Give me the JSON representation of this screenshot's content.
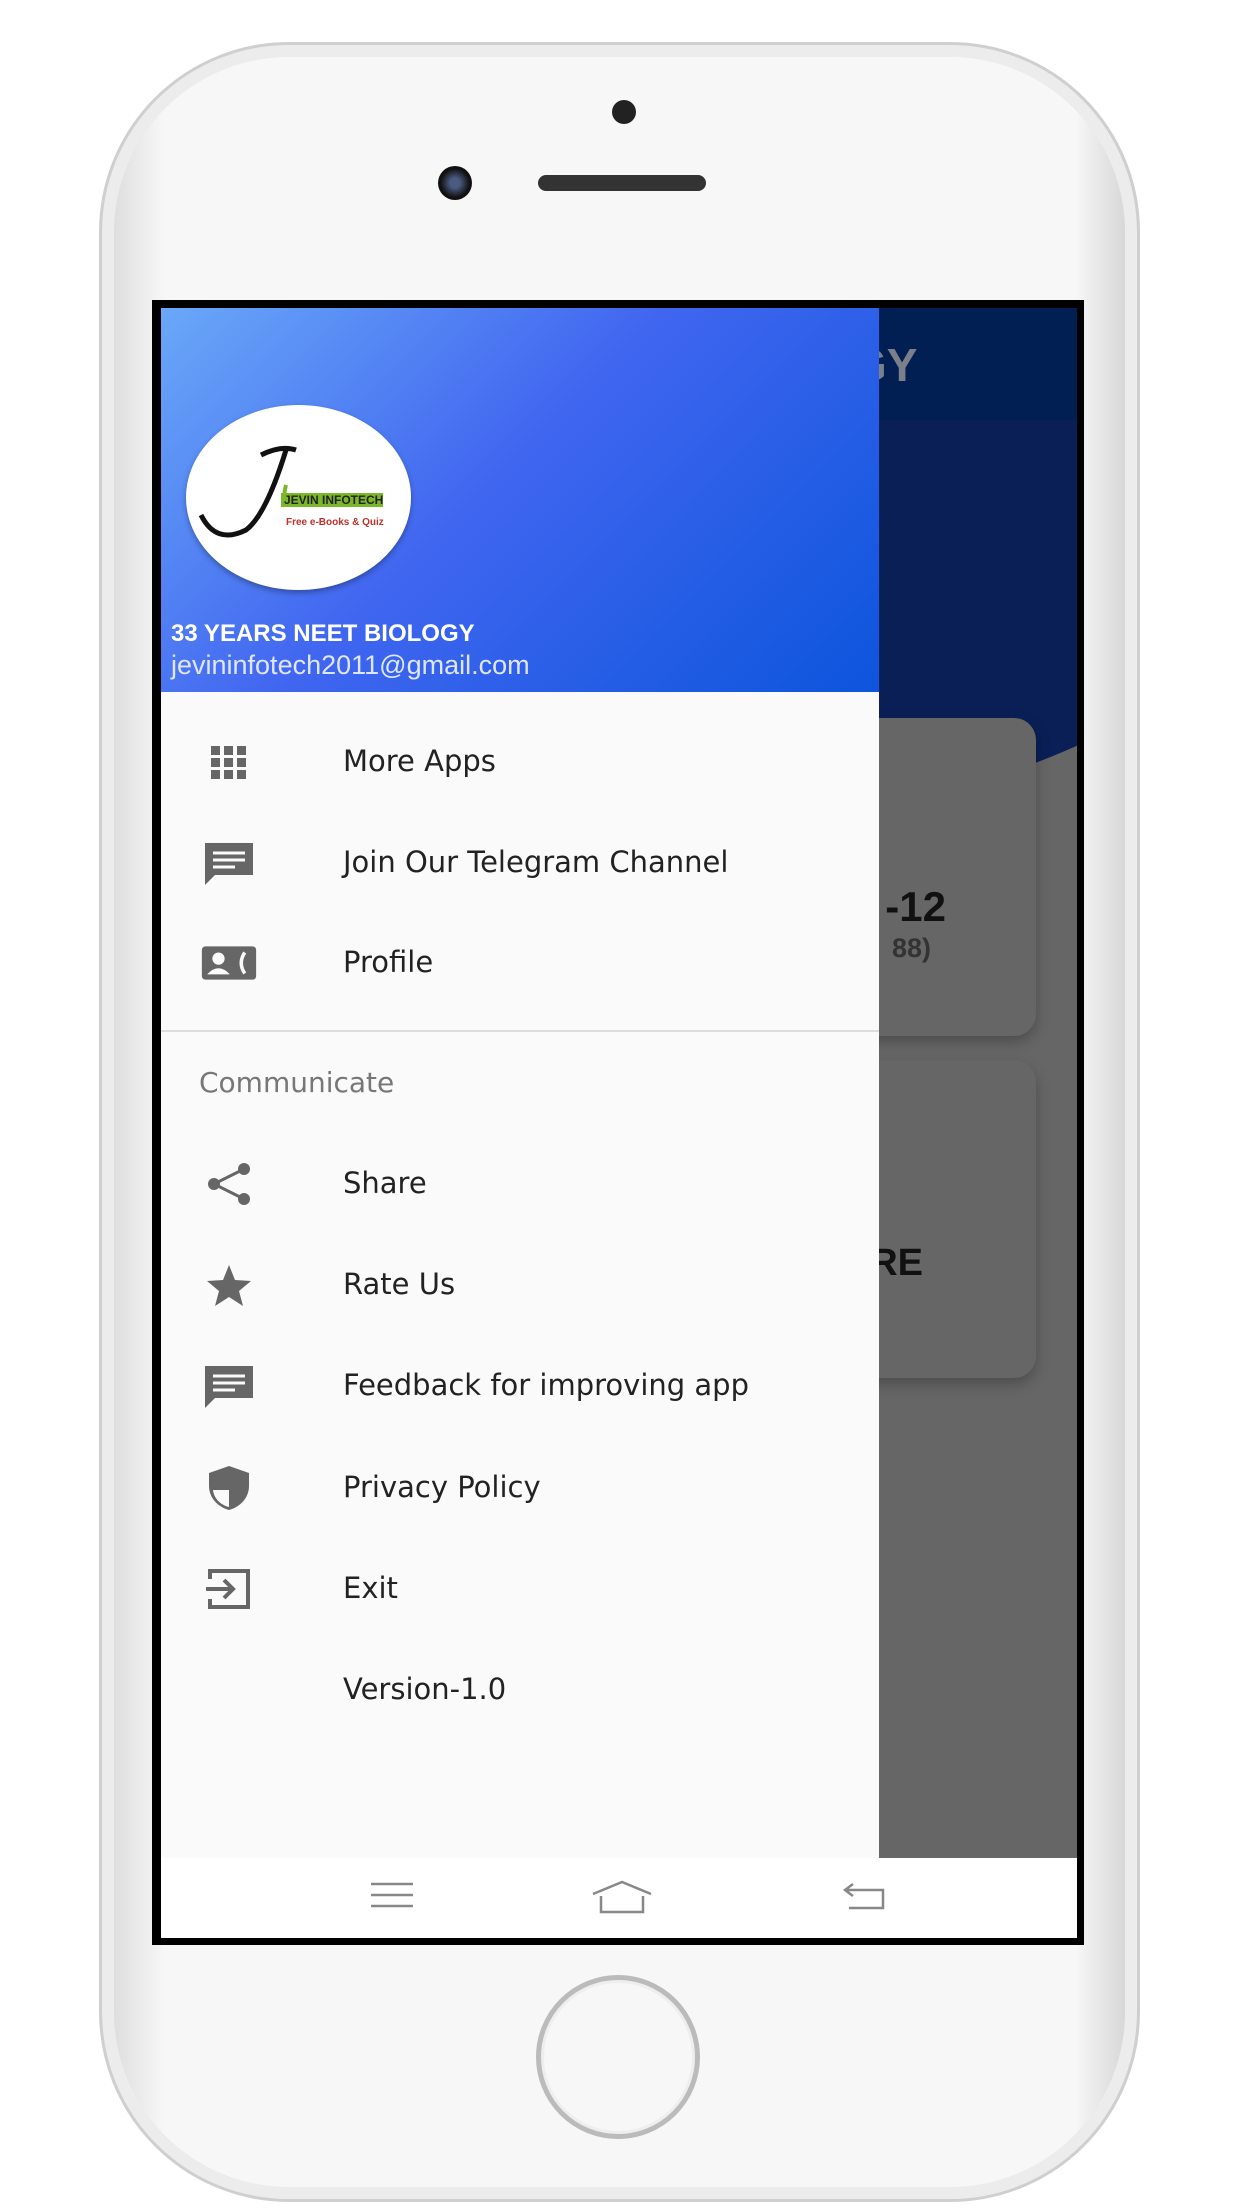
{
  "background_app": {
    "title_fragment": "GY",
    "card1_title": "-12",
    "card1_sub": "88)",
    "card2_title": "RE"
  },
  "drawer": {
    "header": {
      "logo_text": "JEVIN INFOTECH Free e-Books & Quiz",
      "app_name": "33 YEARS NEET BIOLOGY",
      "email": "jevininfotech2011@gmail.com"
    },
    "items": [
      {
        "label": "More Apps",
        "icon": "grid-icon"
      },
      {
        "label": "Join Our Telegram Channel",
        "icon": "message-icon"
      },
      {
        "label": "Profile",
        "icon": "contact-phone-icon"
      }
    ],
    "section_label": "Communicate",
    "communicate_items": [
      {
        "label": "Share",
        "icon": "share-icon"
      },
      {
        "label": "Rate Us",
        "icon": "star-icon"
      },
      {
        "label": "Feedback for improving app",
        "icon": "message-icon"
      },
      {
        "label": "Privacy Policy",
        "icon": "shield-icon"
      },
      {
        "label": "Exit",
        "icon": "exit-icon"
      }
    ],
    "version": "Version-1.0"
  },
  "colors": {
    "header_start": "#6aa8f8",
    "header_end": "#0c55dc",
    "icon": "#666666",
    "scrim": "#666666"
  }
}
